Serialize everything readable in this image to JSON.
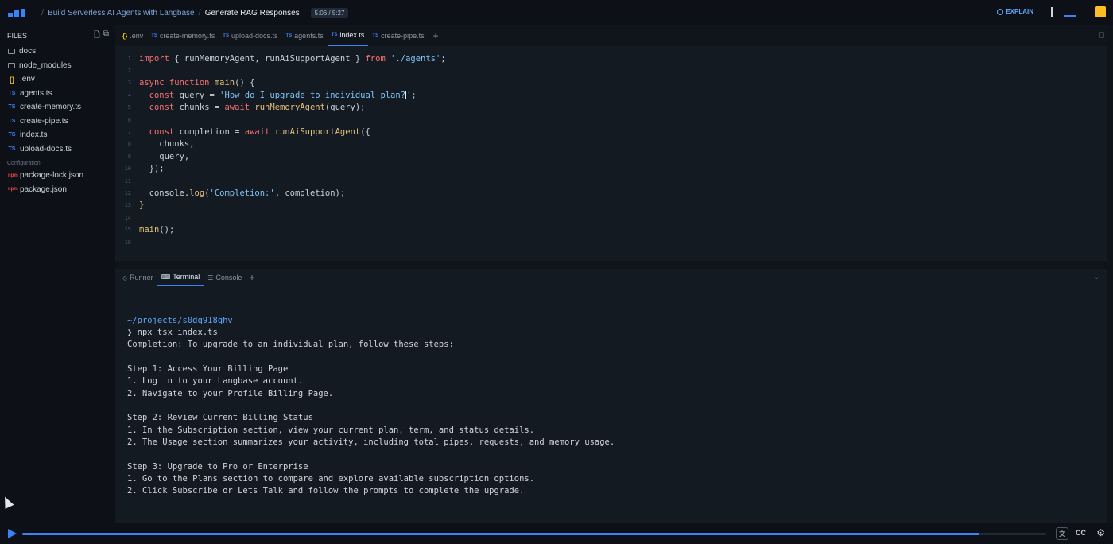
{
  "topbar": {
    "breadcrumb_course": "Build Serverless AI Agents with Langbase",
    "breadcrumb_lesson": "Generate RAG Responses",
    "time": "5:06 / 5:27",
    "explain_label": "EXPLAIN"
  },
  "sidebar": {
    "title": "FILES",
    "items": [
      {
        "label": "docs",
        "icon": "folder-icon"
      },
      {
        "label": "node_modules",
        "icon": "folder-icon"
      },
      {
        "label": ".env",
        "icon": "env-icon",
        "glyph": "{}"
      },
      {
        "label": "agents.ts",
        "icon": "ts-icon",
        "glyph": "TS"
      },
      {
        "label": "create-memory.ts",
        "icon": "ts-icon",
        "glyph": "TS"
      },
      {
        "label": "create-pipe.ts",
        "icon": "ts-icon",
        "glyph": "TS"
      },
      {
        "label": "index.ts",
        "icon": "ts-icon",
        "glyph": "TS"
      },
      {
        "label": "upload-docs.ts",
        "icon": "ts-icon",
        "glyph": "TS"
      }
    ],
    "section_label": "Configuration",
    "config_items": [
      {
        "label": "package-lock.json",
        "glyph": "npm"
      },
      {
        "label": "package.json",
        "glyph": "npm"
      }
    ]
  },
  "editor": {
    "tabs": [
      {
        "label": ".env",
        "glyph": "{}"
      },
      {
        "label": "create-memory.ts",
        "glyph": "TS"
      },
      {
        "label": "upload-docs.ts",
        "glyph": "TS"
      },
      {
        "label": "agents.ts",
        "glyph": "TS"
      },
      {
        "label": "index.ts",
        "glyph": "TS",
        "active": true
      },
      {
        "label": "create-pipe.ts",
        "glyph": "TS"
      }
    ],
    "line_numbers": [
      "1",
      "2",
      "3",
      "4",
      "5",
      "6",
      "7",
      "8",
      "9",
      "10",
      "11",
      "12",
      "13",
      "14",
      "15",
      "16"
    ],
    "code": {
      "l1_kw1": "import",
      "l1_rest": " { runMemoryAgent, runAiSupportAgent } ",
      "l1_kw2": "from",
      "l1_str": " './agents'",
      "l1_end": ";",
      "l3_kw1": "async",
      "l3_kw2": " function",
      "l3_fn": " main",
      "l3_end": "() {",
      "l4_kw": "  const",
      "l4_id": " query = ",
      "l4_str": "'How do I upgrade to individual plan?",
      "l4_end": "';",
      "l5_kw": "  const",
      "l5_id": " chunks = ",
      "l5_kw2": "await",
      "l5_fn": " runMemoryAgent",
      "l5_end": "(query);",
      "l7_kw": "  const",
      "l7_id": " completion = ",
      "l7_kw2": "await",
      "l7_fn": " runAiSupportAgent",
      "l7_end": "({",
      "l8": "    chunks,",
      "l9": "    query,",
      "l10": "  });",
      "l12_id": "  console.",
      "l12_fn": "log",
      "l12_p": "(",
      "l12_str": "'Completion:'",
      "l12_end": ", completion);",
      "l13": "}",
      "l15_fn": "main",
      "l15_end": "();"
    }
  },
  "panel": {
    "tabs": [
      {
        "label": "Runner",
        "glyph": "◇"
      },
      {
        "label": "Terminal",
        "glyph": "⌨",
        "active": true
      },
      {
        "label": "Console",
        "glyph": "☰"
      }
    ],
    "terminal_lines": [
      "~/projects/s0dq918qhv",
      "❯ npx tsx index.ts",
      "Completion: To upgrade to an individual plan, follow these steps:",
      "",
      "Step 1: Access Your Billing Page",
      "1. Log in to your Langbase account.",
      "2. Navigate to your Profile Billing Page.",
      "",
      "Step 2: Review Current Billing Status",
      "1. In the Subscription section, view your current plan, term, and status details.",
      "2. The Usage section summarizes your activity, including total pipes, requests, and memory usage.",
      "",
      "Step 3: Upgrade to Pro or Enterprise",
      "1. Go to the Plans section to compare and explore available subscription options.",
      "2. Click Subscribe or Lets Talk and follow the prompts to complete the upgrade."
    ]
  },
  "player": {
    "progress": 0.935,
    "cc_label": "CC"
  },
  "colors": {
    "accent": "#3b82f6",
    "background": "#0f141b"
  }
}
